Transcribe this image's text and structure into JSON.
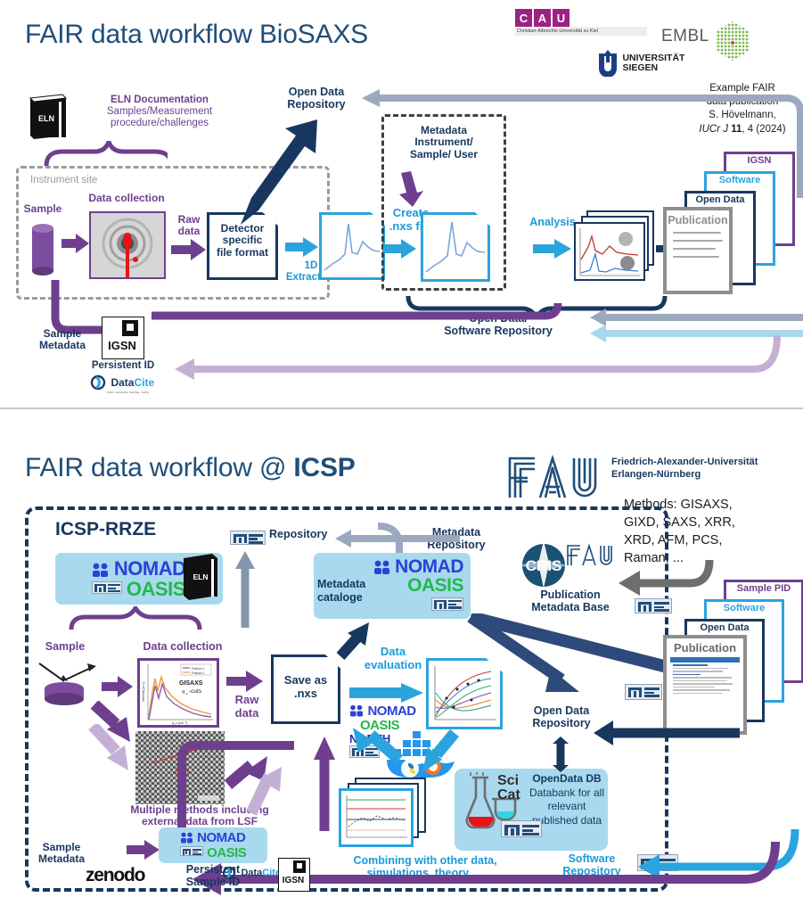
{
  "top": {
    "title": "FAIR data workflow BioSAXS",
    "logos": {
      "cau": {
        "letters": [
          "C",
          "A",
          "U"
        ],
        "sub": "Christian-Albrechts-Universität zu Kiel"
      },
      "embl": "EMBL",
      "siegen": {
        "l1": "UNIVERSITÄT",
        "l2": "SIEGEN"
      }
    },
    "example_note": {
      "l1": "Example FAIR",
      "l2": "data publication",
      "l3": "S. Hövelmann,",
      "l4_italic": "IUCr J",
      "l4_bold": "11",
      "l4_rest": ", 4 (2024)"
    },
    "eln": {
      "badge": "ELN",
      "title": "ELN Documentation",
      "l2": "Samples/Measurement",
      "l3": "procedure/challenges"
    },
    "instrument_site": "Instrument site",
    "sample": "Sample",
    "data_collection": "Data collection",
    "raw_data": {
      "l1": "Raw",
      "l2": "data"
    },
    "detector": {
      "l1": "Detector",
      "l2": "specific",
      "l3": "file format"
    },
    "extraction": {
      "l1": "1D",
      "l2": "Extraction"
    },
    "metadata_box": {
      "l1": "Metadata",
      "l2": "Instrument/",
      "l3": "Sample/ User"
    },
    "create_nxs": {
      "l1": "Create",
      "l2": ".nxs file"
    },
    "analysis": "Analysis",
    "open_data_repo": {
      "l1": "Open Data",
      "l2": "Repository"
    },
    "open_data_sw_repo": {
      "l1": "Open Data/",
      "l2": "Software Repository"
    },
    "sample_metadata": {
      "l1": "Sample",
      "l2": "Metadata"
    },
    "igsn": "IGSN",
    "persistent_id": "Persistent ID",
    "datacite": "DataCite",
    "stack": {
      "igsn": "IGSN",
      "software": "Software",
      "open_data": "Open Data",
      "publication": "Publication"
    }
  },
  "bottom": {
    "title_plain": "FAIR data workflow @ ",
    "title_bold": "ICSP",
    "fau": {
      "mark": "FAU",
      "l1": "Friedrich-Alexander-Universität",
      "l2": "Erlangen-Nürnberg"
    },
    "methods": {
      "l1": "Methods: GISAXS,",
      "l2": "GIXD, SAXS, XRR,",
      "l3": "XRD, AFM, PCS,",
      "l4": "Raman, ..."
    },
    "icsp_rrze": "ICSP-RRZE",
    "repository": "Repository",
    "metadata_repository": {
      "l1": "Metadata",
      "l2": "Repository"
    },
    "nomad": {
      "n": "NOMAD",
      "o": "OASIS"
    },
    "eln_badge": "ELN",
    "metadata_catalogue": {
      "l1": "Metadata",
      "l2": "cataloge"
    },
    "cris": {
      "mark": "CRIS",
      "fau": "FAU",
      "l1": "Publication",
      "l2": "Metadata Base"
    },
    "sample": "Sample",
    "data_collection": "Data collection",
    "gisaxs_plot": {
      "l1": "GISAXS",
      "l2": "q_z-cuts",
      "leg1": "Position 1",
      "leg2": "Position 2",
      "ylab": "Intensity [a.u.]",
      "xlab": "q_z (nm⁻¹)"
    },
    "raw_data": {
      "l1": "Raw",
      "l2": "data"
    },
    "save_as": {
      "l1": "Save as",
      "l2": ".nxs"
    },
    "data_evaluation": {
      "l1": "Data",
      "l2": "evaluation"
    },
    "north": "NORTH",
    "multiple_methods": {
      "l1": "Multiple methods including",
      "l2": "external data from LSF"
    },
    "sample_metadata": {
      "l1": "Sample",
      "l2": "Metadata"
    },
    "zenodo": "zenodo",
    "persistent_sample_id": {
      "l1": "Persistent",
      "l2": "Sample ID"
    },
    "datacite": "DataCite",
    "igsn": "IGSN",
    "combining": {
      "l1": "Combining with other data,",
      "l2": "simulations, theory, ..."
    },
    "scicat": {
      "sci": "Sci",
      "cat": "Cat",
      "t1": "OpenData DB",
      "t2": "Databank for all",
      "t3": "relevant",
      "t4": "published data"
    },
    "open_data_repo": {
      "l1": "Open Data",
      "l2": "Repository"
    },
    "software_repo": {
      "l1": "Software",
      "l2": "Repository"
    },
    "stack": {
      "sample_pid": "Sample PID",
      "software": "Software",
      "open_data": "Open Data",
      "publication": "Publication"
    }
  },
  "colors": {
    "navy": "#17375E",
    "purple": "#6E3F8E",
    "cyan": "#2BA4DE",
    "light_purple": "#C5B0D5",
    "steel": "#9AA9BE",
    "grey": "#8E8E8E",
    "light_blue": "#A8D9EE",
    "green": "#25B84C",
    "magenta": "#9B2283"
  }
}
